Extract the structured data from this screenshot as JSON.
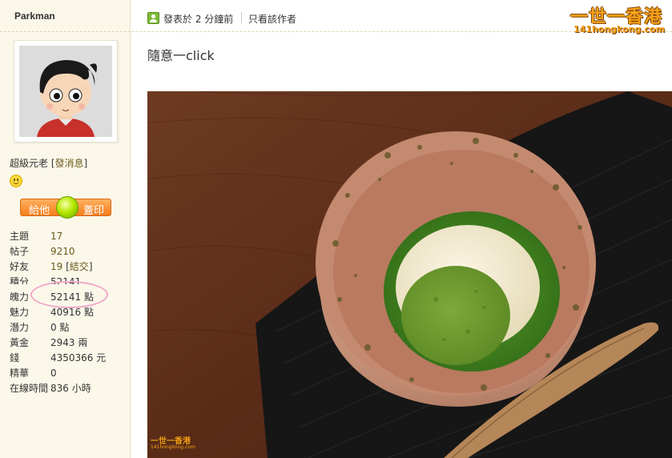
{
  "user": {
    "name": "Parkman",
    "rank": "超級元老",
    "message_link": "發消息"
  },
  "stamp_button": {
    "left": "給他",
    "right": "蓋印"
  },
  "stats": [
    {
      "key": "主題",
      "value": "17"
    },
    {
      "key": "帖子",
      "value": "9210"
    },
    {
      "key": "好友",
      "value": "19",
      "extra": "結交"
    },
    {
      "key": "積分",
      "value": "52141"
    },
    {
      "key": "魄力",
      "value": "52141 點"
    },
    {
      "key": "魅力",
      "value": "40916 點"
    },
    {
      "key": "潛力",
      "value": "0 點"
    },
    {
      "key": "黃金",
      "value": "2943 兩"
    },
    {
      "key": "錢",
      "value": "4350366 元"
    },
    {
      "key": "精華",
      "value": "0"
    },
    {
      "key": "在線時間",
      "value": "836 小時"
    }
  ],
  "post": {
    "time": "發表於 2 分鐘前",
    "author_only": "只看該作者",
    "title": "隨意一click"
  },
  "logo": {
    "main": "一世一香港",
    "sub": "141hongkong.com"
  },
  "watermark": {
    "main": "一世一香港",
    "sub": "141hongkong.com"
  },
  "colors": {
    "accent": "#f7a21a",
    "sidebar_bg": "#fbf8ea",
    "link": "#6b5a1e"
  }
}
